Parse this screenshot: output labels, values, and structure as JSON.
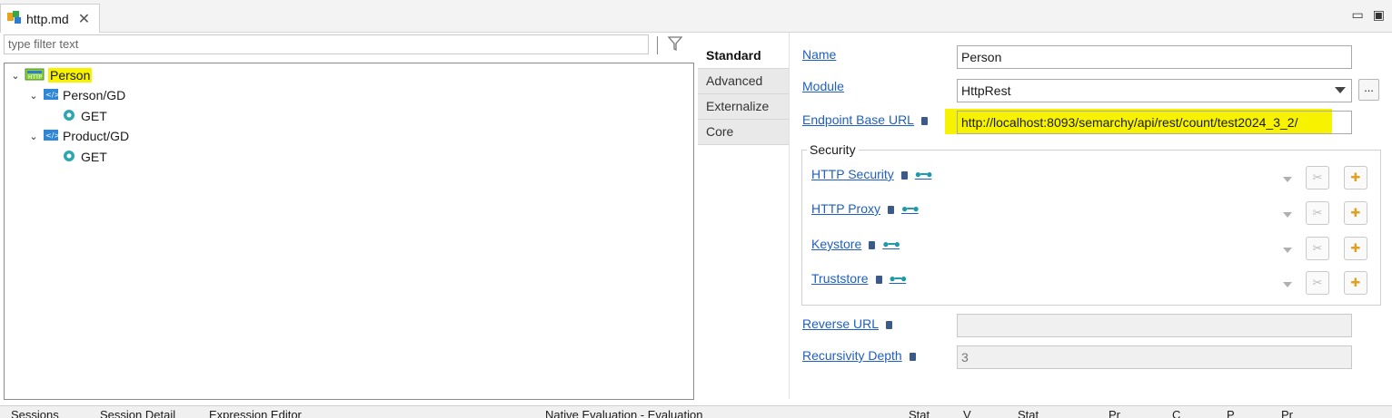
{
  "editor": {
    "tab_title": "http.md",
    "tab_icon": "http-model-icon",
    "minimize_label": "▭",
    "maximize_label": "▣"
  },
  "tree": {
    "filter_placeholder": "type filter text",
    "nodes": [
      {
        "label": "Person",
        "icon": "rest-service-icon",
        "highlighted": true
      },
      {
        "label": "Person/GD",
        "icon": "endpoint-icon"
      },
      {
        "label": "GET",
        "icon": "method-gear-icon"
      },
      {
        "label": "Product/GD",
        "icon": "endpoint-icon"
      },
      {
        "label": "GET",
        "icon": "method-gear-icon"
      }
    ]
  },
  "vtabs": [
    "Standard",
    "Advanced",
    "Externalize",
    "Core"
  ],
  "properties": {
    "name_label": "Name",
    "name_value": "Person",
    "module_label": "Module",
    "module_value": "HttpRest",
    "module_button": "...",
    "endpoint_label": "Endpoint Base URL",
    "endpoint_value": "http://localhost:8093/semarchy/api/rest/count/test2024_3_2/",
    "security_legend": "Security",
    "security_items": [
      "HTTP Security",
      "HTTP Proxy",
      "Keystore",
      "Truststore"
    ],
    "reverse_label": "Reverse URL",
    "reverse_value": "",
    "depth_label": "Recursivity Depth",
    "depth_value": "3"
  },
  "bottom": {
    "items": [
      "Sessions",
      "Session Detail",
      "Expression Editor",
      "Native Evaluation - Evaluation",
      "Stat",
      "V",
      "Stat",
      "Pr",
      "C",
      "P",
      "Pr"
    ]
  },
  "colors": {
    "highlight": "#f7f300",
    "link": "#1f5fbf"
  }
}
